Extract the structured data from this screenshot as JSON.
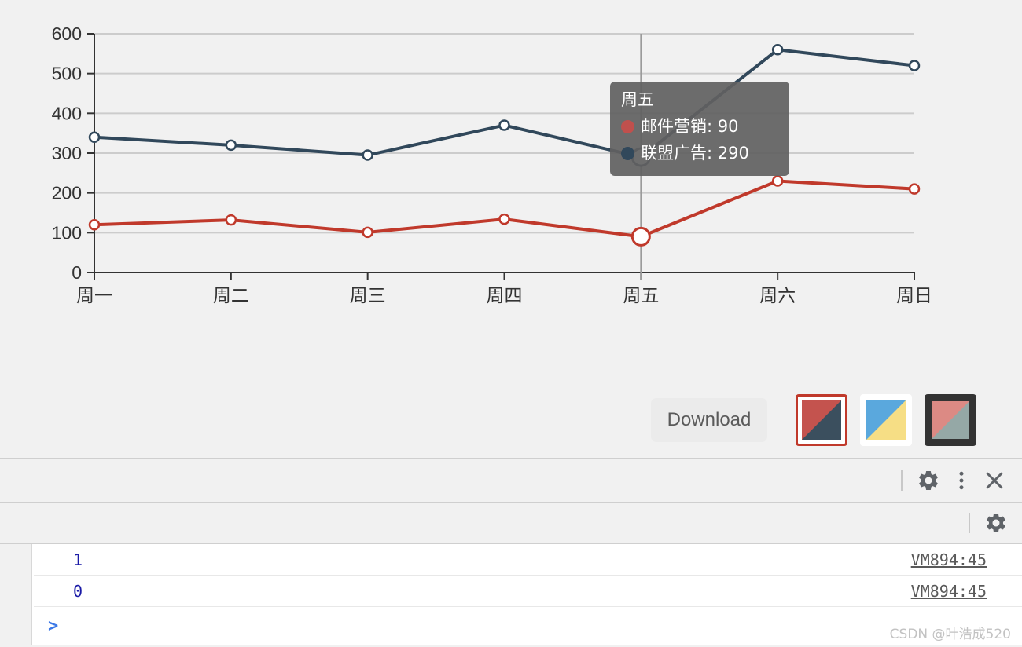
{
  "chart_data": {
    "type": "line",
    "title": "",
    "xlabel": "",
    "ylabel": "",
    "categories": [
      "周一",
      "周二",
      "周三",
      "周四",
      "周五",
      "周六",
      "周日"
    ],
    "ylim": [
      0,
      600
    ],
    "yticks": [
      "0",
      "100",
      "200",
      "300",
      "400",
      "500",
      "600"
    ],
    "grid": true,
    "legend_position": "none",
    "series": [
      {
        "name": "邮件营销",
        "color": "#c0392b",
        "values": [
          120,
          132,
          101,
          134,
          90,
          230,
          210
        ]
      },
      {
        "name": "联盟广告",
        "color": "#31485b",
        "values": [
          340,
          320,
          295,
          370,
          290,
          560,
          520
        ]
      }
    ]
  },
  "tooltip": {
    "title": "周五",
    "rows": [
      {
        "label_value": "邮件营销: 90",
        "color": "#c0504d"
      },
      {
        "label_value": "联盟广告: 290",
        "color": "#31485b"
      }
    ]
  },
  "toolbar": {
    "download_label": "Download",
    "themes": [
      {
        "name": "theme-red-navy",
        "selected": true,
        "color_a": "#c4534e",
        "color_b": "#3b4f5e",
        "border": "#c0392b"
      },
      {
        "name": "theme-blue-yellow",
        "selected": false,
        "color_a": "#5aa8dd",
        "color_b": "#f6de85",
        "border": "#ffffff"
      },
      {
        "name": "theme-salmon-gray",
        "selected": false,
        "color_a": "#dc8a84",
        "color_b": "#95a8a6",
        "border": "#333333"
      }
    ]
  },
  "devtools": {
    "topbar": {
      "settings_icon": "gear-icon",
      "more_icon": "vertical-dots-icon",
      "close_icon": "close-icon"
    },
    "filterbar": {
      "settings_icon": "gear-icon"
    },
    "console": {
      "messages": [
        {
          "value": "1",
          "source": "VM894:45"
        },
        {
          "value": "0",
          "source": "VM894:45"
        }
      ],
      "prompt": ">",
      "input_value": "",
      "input_placeholder": ""
    }
  },
  "watermark": "CSDN @叶浩成520"
}
